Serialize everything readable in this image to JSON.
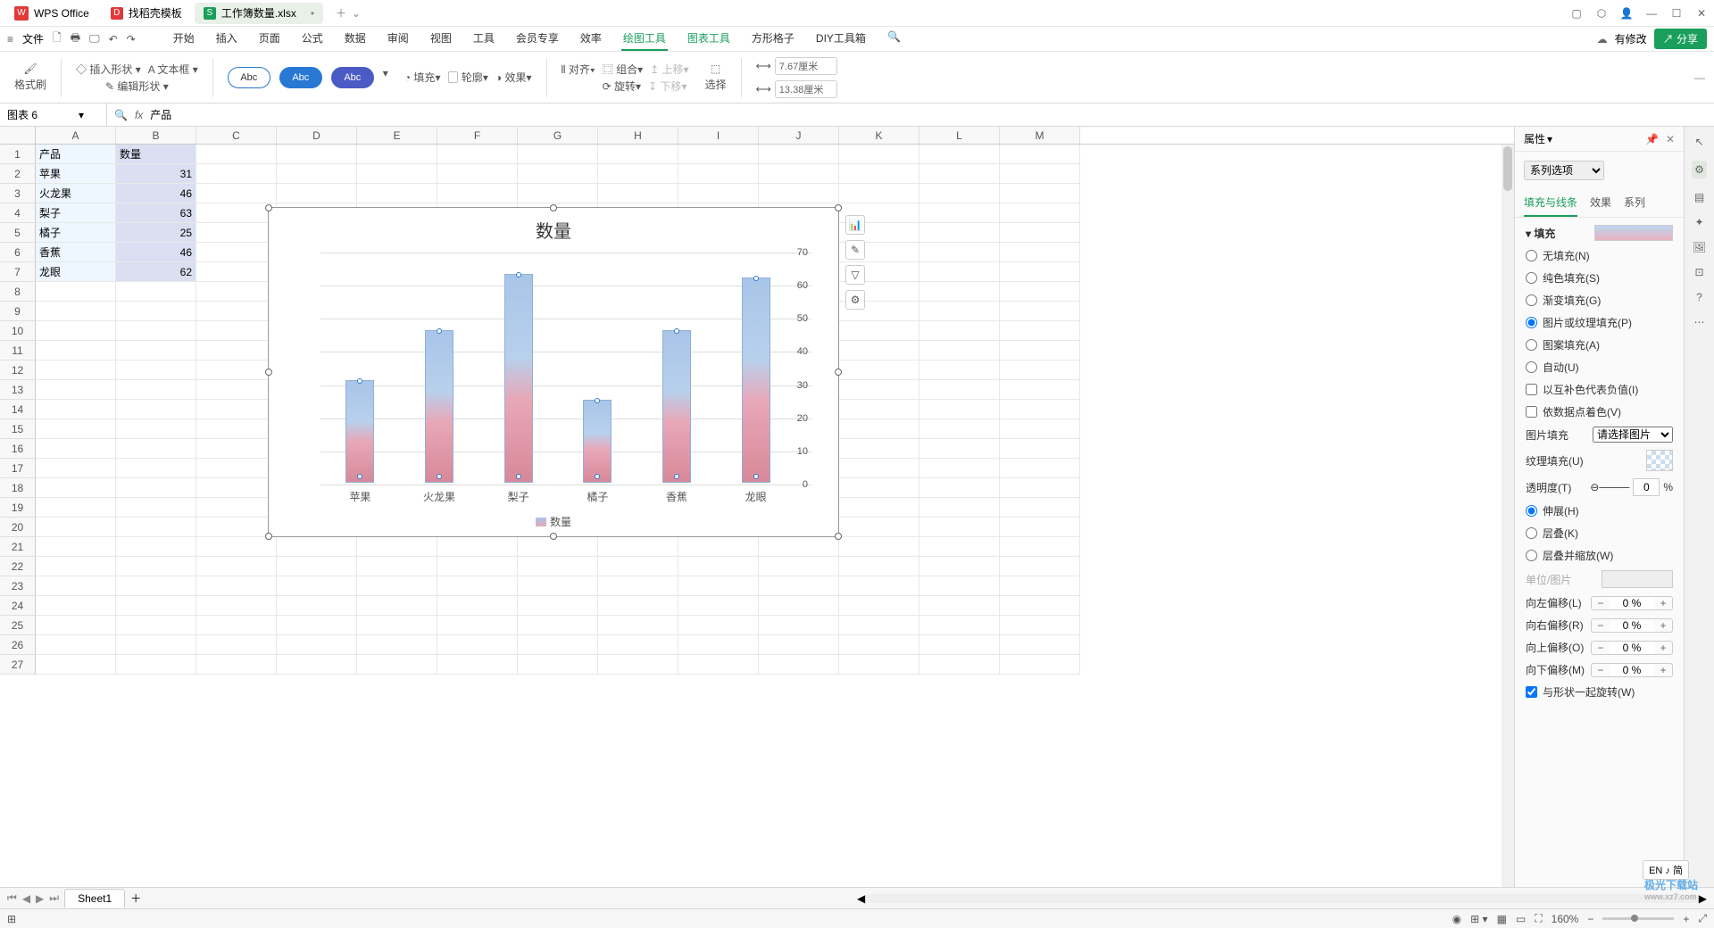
{
  "title_bar": {
    "app": "WPS Office",
    "tab2": "找稻壳模板",
    "tab3": "工作簿数量.xlsx"
  },
  "quick": {
    "file": "文件"
  },
  "menu": {
    "items": [
      "开始",
      "插入",
      "页面",
      "公式",
      "数据",
      "审阅",
      "视图",
      "工具",
      "会员专享",
      "效率",
      "绘图工具",
      "图表工具",
      "方形格子",
      "DIY工具箱"
    ],
    "active_index": 10,
    "modify": "有修改",
    "share": "分享"
  },
  "ribbon": {
    "format_painter": "格式刷",
    "insert_shape": "插入形状",
    "text_box": "文本框",
    "edit_shape": "编辑形状",
    "abc": "Abc",
    "fill": "填充",
    "outline": "轮廓",
    "effects": "效果",
    "align": "对齐",
    "group": "组合",
    "rotate": "旋转",
    "move_up": "上移",
    "move_down": "下移",
    "select": "选择",
    "width": "7.67厘米",
    "height": "13.38厘米"
  },
  "name_box": "图表 6",
  "formula_value": "产品",
  "table": {
    "headers": [
      "产品",
      "数量"
    ],
    "rows": [
      [
        "苹果",
        "31"
      ],
      [
        "火龙果",
        "46"
      ],
      [
        "梨子",
        "63"
      ],
      [
        "橘子",
        "25"
      ],
      [
        "香蕉",
        "46"
      ],
      [
        "龙眼",
        "62"
      ]
    ]
  },
  "chart_data": {
    "type": "bar",
    "title": "数量",
    "categories": [
      "苹果",
      "火龙果",
      "梨子",
      "橘子",
      "香蕉",
      "龙眼"
    ],
    "values": [
      31,
      46,
      63,
      25,
      46,
      62
    ],
    "ylim": [
      0,
      70
    ],
    "yticks": [
      0,
      10,
      20,
      30,
      40,
      50,
      60,
      70
    ],
    "legend": "数量"
  },
  "panel": {
    "title": "属性",
    "series_select": "系列选项",
    "tabs": [
      "填充与线条",
      "效果",
      "系列"
    ],
    "section_fill": "填充",
    "fill_options": {
      "none": "无填充(N)",
      "solid": "纯色填充(S)",
      "gradient": "渐变填充(G)",
      "picture": "图片或纹理填充(P)",
      "pattern": "图案填充(A)",
      "auto": "自动(U)"
    },
    "neg_color": "以互补色代表负值(I)",
    "per_point": "依数据点着色(V)",
    "pic_fill": "图片填充",
    "pic_select": "请选择图片",
    "tex_fill": "纹理填充(U)",
    "transparency": "透明度(T)",
    "trans_val": "0",
    "stretch": "伸展(H)",
    "stack": "层叠(K)",
    "stack_scale": "层叠并缩放(W)",
    "unit": "单位/图片",
    "off_l": "向左偏移(L)",
    "off_r": "向右偏移(R)",
    "off_t": "向上偏移(O)",
    "off_b": "向下偏移(M)",
    "off_val": "0 %",
    "rotate_with": "与形状一起旋转(W)"
  },
  "sheet": {
    "name": "Sheet1"
  },
  "status": {
    "zoom": "160%",
    "ime": "EN ♪ 简"
  },
  "columns": [
    "A",
    "B",
    "C",
    "D",
    "E",
    "F",
    "G",
    "H",
    "I",
    "J",
    "K",
    "L",
    "M"
  ],
  "watermark": {
    "t": "极光下载站",
    "u": "www.xz7.com"
  }
}
